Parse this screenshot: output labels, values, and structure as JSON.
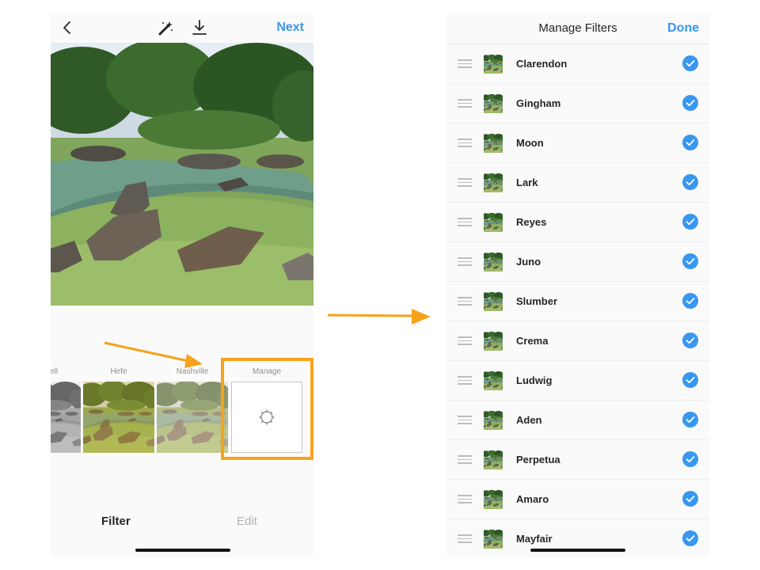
{
  "editor": {
    "header": {
      "back_icon": "chevron-left-icon",
      "magic_icon": "magic-wand-icon",
      "download_icon": "download-icon",
      "next_label": "Next"
    },
    "filters": [
      {
        "label": "ell",
        "style": "bw"
      },
      {
        "label": "Hefe",
        "style": "warm"
      },
      {
        "label": "Nashville",
        "style": "faded"
      }
    ],
    "manage": {
      "label": "Manage",
      "icon": "gear-outline-icon"
    },
    "tabs": {
      "filter_label": "Filter",
      "edit_label": "Edit"
    },
    "accent_color": "#3897f0",
    "annotation_color": "#f7a21b"
  },
  "manage_filters": {
    "title": "Manage Filters",
    "done_label": "Done",
    "items": [
      {
        "label": "Clarendon",
        "checked": true
      },
      {
        "label": "Gingham",
        "checked": true
      },
      {
        "label": "Moon",
        "checked": true
      },
      {
        "label": "Lark",
        "checked": true
      },
      {
        "label": "Reyes",
        "checked": true
      },
      {
        "label": "Juno",
        "checked": true
      },
      {
        "label": "Slumber",
        "checked": true
      },
      {
        "label": "Crema",
        "checked": true
      },
      {
        "label": "Ludwig",
        "checked": true
      },
      {
        "label": "Aden",
        "checked": true
      },
      {
        "label": "Perpetua",
        "checked": true
      },
      {
        "label": "Amaro",
        "checked": true
      },
      {
        "label": "Mayfair",
        "checked": true
      }
    ]
  }
}
